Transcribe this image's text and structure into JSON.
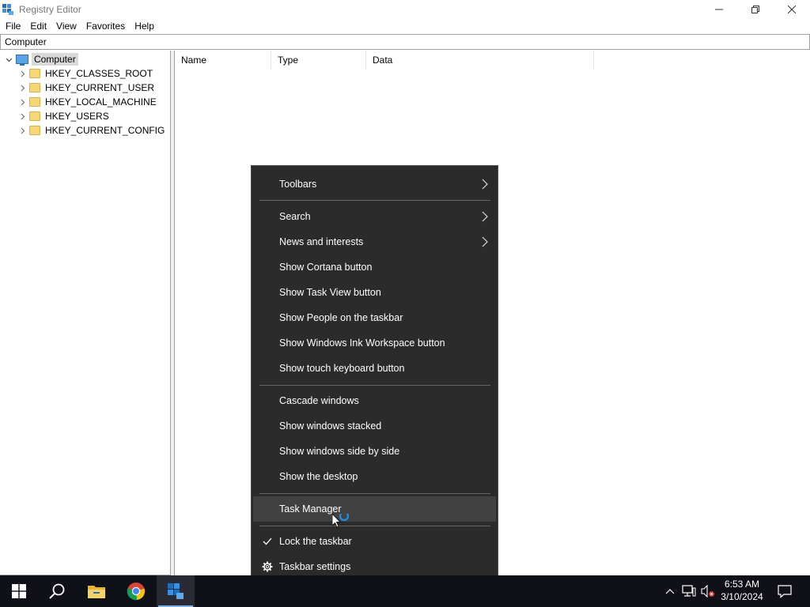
{
  "window": {
    "title": "Registry Editor",
    "minimize_glyph": "—",
    "restore_glyph": "❐",
    "close_glyph": "✕"
  },
  "menubar": {
    "items": [
      "File",
      "Edit",
      "View",
      "Favorites",
      "Help"
    ]
  },
  "address": {
    "path": "Computer"
  },
  "tree": {
    "root": "Computer",
    "keys": [
      "HKEY_CLASSES_ROOT",
      "HKEY_CURRENT_USER",
      "HKEY_LOCAL_MACHINE",
      "HKEY_USERS",
      "HKEY_CURRENT_CONFIG"
    ]
  },
  "list": {
    "columns": [
      "Name",
      "Type",
      "Data"
    ]
  },
  "context_menu": {
    "items": {
      "toolbars": "Toolbars",
      "search": "Search",
      "news": "News and interests",
      "cortana": "Show Cortana button",
      "task_view": "Show Task View button",
      "people": "Show People on the taskbar",
      "ink": "Show Windows Ink Workspace button",
      "touch_keyboard": "Show touch keyboard button",
      "cascade": "Cascade windows",
      "stacked": "Show windows stacked",
      "side_by_side": "Show windows side by side",
      "desktop": "Show the desktop",
      "task_manager": "Task Manager",
      "lock": "Lock the taskbar",
      "settings": "Taskbar settings"
    },
    "highlighted": "task_manager",
    "lock_checked": true
  },
  "taskbar": {
    "apps": [
      "windows-start-icon",
      "search-icon",
      "file-explorer-icon",
      "chrome-icon",
      "registry-editor-icon"
    ],
    "active_app": "registry-editor-icon",
    "time": "6:53 AM",
    "date": "3/10/2024"
  },
  "colors": {
    "menu_bg": "#2b2b2b",
    "menu_highlight": "#414141",
    "taskbar_bg": "#101018",
    "folder": "#f6d675"
  }
}
